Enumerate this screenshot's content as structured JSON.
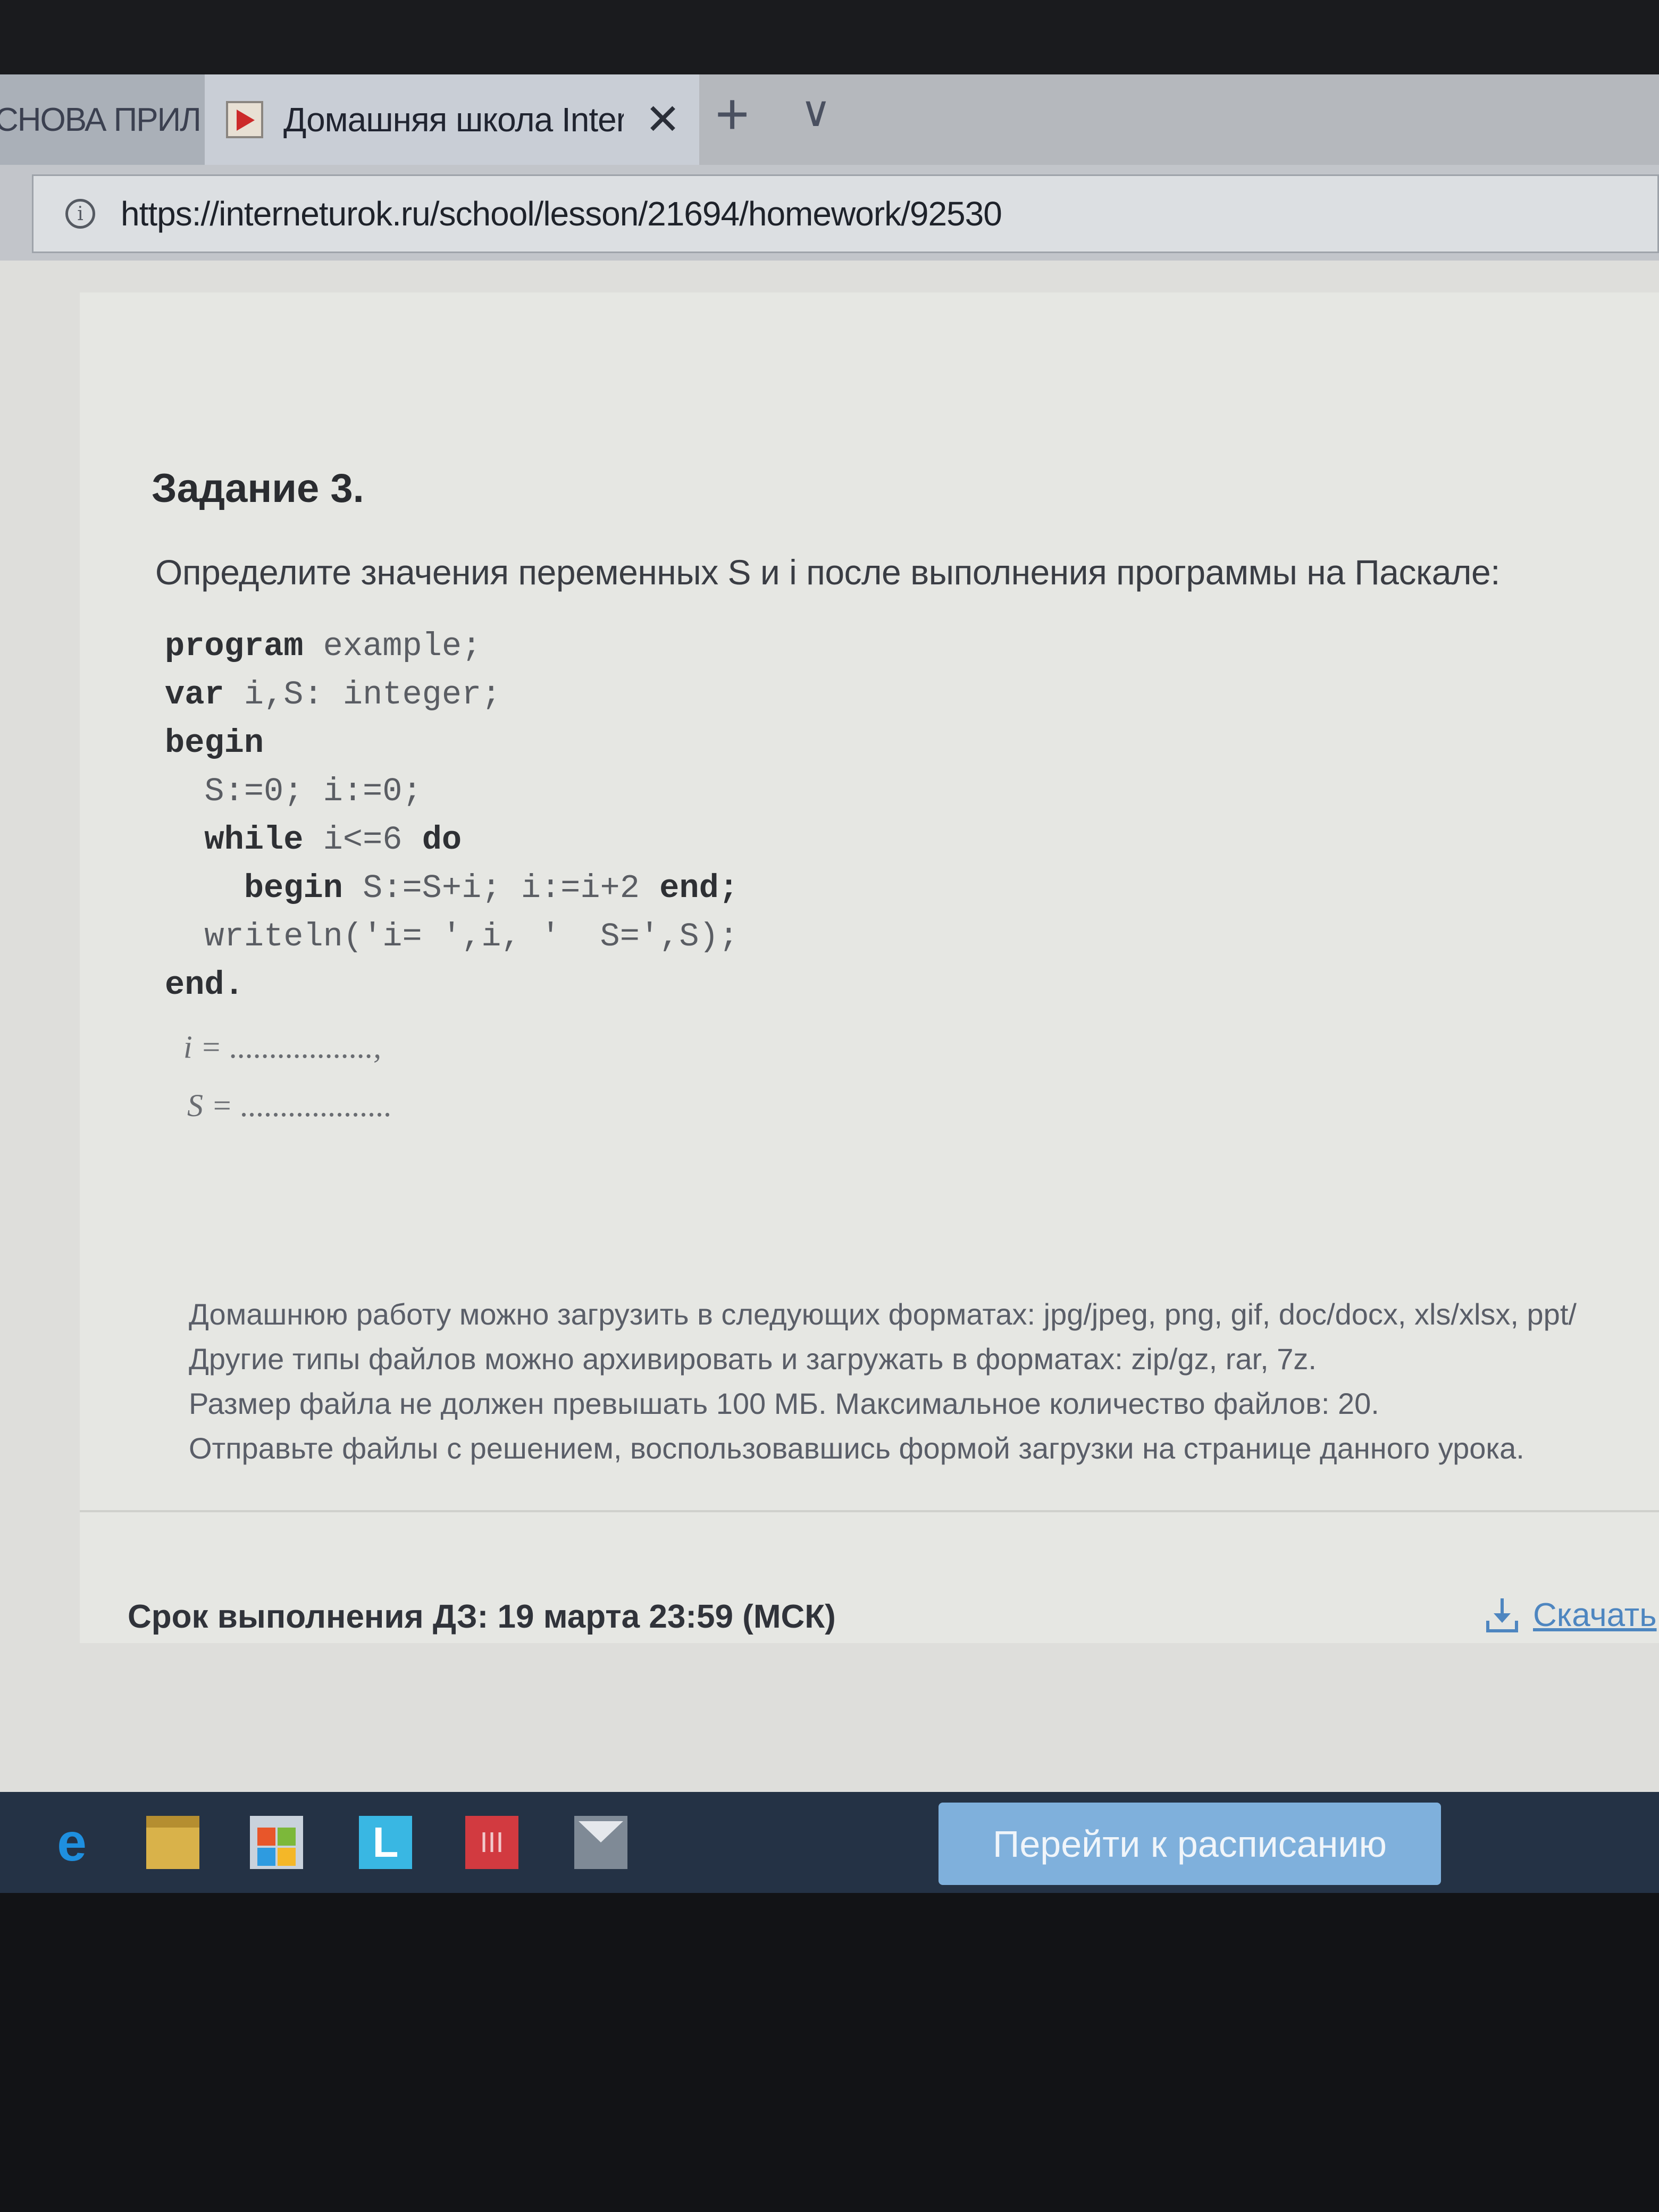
{
  "browser": {
    "tabs": [
      {
        "label": "СНОВА ПРИЛ"
      },
      {
        "label": "Домашняя школа Inter",
        "active": true
      }
    ],
    "new_tab_symbol": "+",
    "tab_menu_symbol": "∨",
    "close_symbol": "✕",
    "address": {
      "url": "https://interneturok.ru/school/lesson/21694/homework/92530",
      "info_symbol": "i"
    }
  },
  "task": {
    "title": "Задание 3.",
    "prompt": "Определите значения переменных S и i после выполнения программы на Паскале:",
    "code": {
      "line1_kw": "program",
      "line1_rest": " example;",
      "line2_kw": "var",
      "line2_rest": " i,S: integer;",
      "line3_kw": "begin",
      "line4": "  S:=0; i:=0;",
      "line5_kw": "while",
      "line5_mid": " i<=6 ",
      "line5_kw2": "do",
      "line6_kw": "begin",
      "line6_mid": " S:=S+i; i:=i+2 ",
      "line6_kw2": "end;",
      "line7": "  writeln('i= ',i, '  S=',S);",
      "line8_kw": "end."
    },
    "answers": {
      "i_line": "i = ..................,",
      "s_line": "S = ..................."
    }
  },
  "upload_info": [
    "Домашнюю работу можно загрузить в следующих форматах: jpg/jpeg, png, gif, doc/docx, xls/xlsx, ppt/",
    "Другие типы файлов можно архивировать и загружать в форматах: zip/gz, rar, 7z.",
    "Размер файла не должен превышать 100 МБ. Максимальное количество файлов: 20.",
    "Отправьте файлы с решением, воспользовавшись формой загрузки на странице данного урока."
  ],
  "footer": {
    "deadline": "Срок выполнения ДЗ: 19 марта 23:59 (МСК)",
    "download_label": "Скачать",
    "schedule_button": "Перейти к расписанию"
  },
  "taskbar": {
    "icons": [
      "edge-icon",
      "file-explorer-icon",
      "store-icon",
      "l-app-icon",
      "red-app-icon",
      "mail-icon"
    ],
    "l_app_text": "L",
    "red_app_text": "III",
    "edge_text": "e"
  },
  "colors": {
    "accent_link": "#4e86c0",
    "button": "#7fb0dc",
    "taskbar": "#243245"
  }
}
